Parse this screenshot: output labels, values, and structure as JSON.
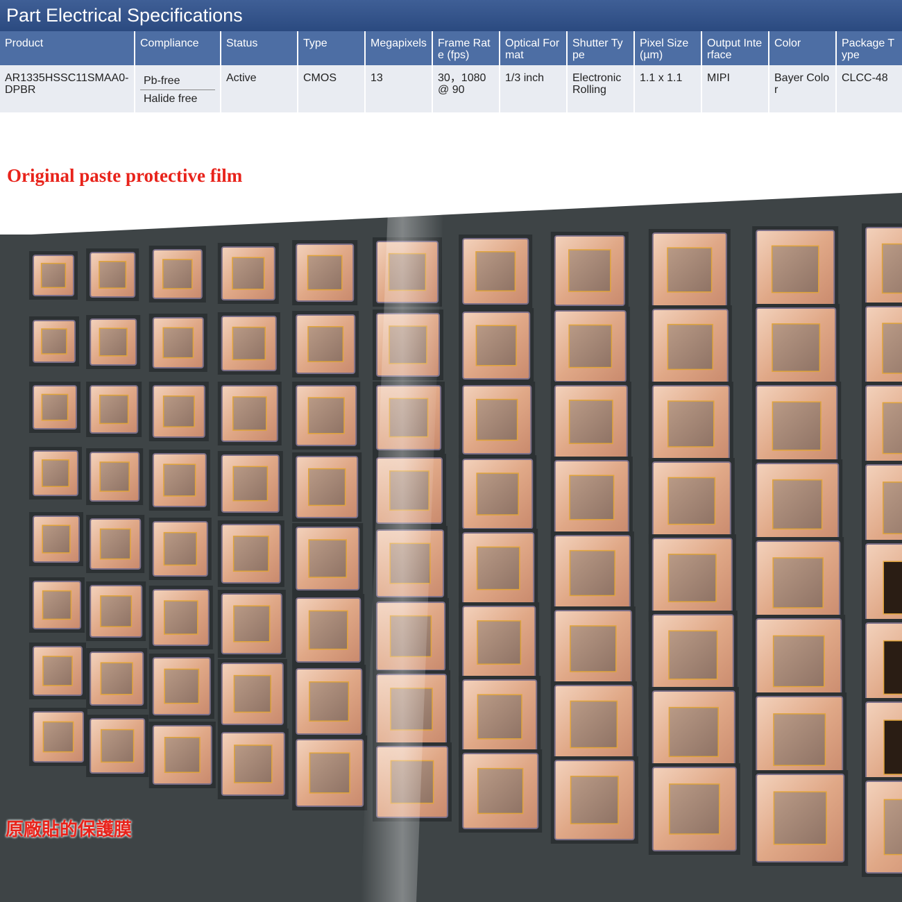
{
  "header": {
    "title": "Part Electrical Specifications"
  },
  "table": {
    "columns": [
      "Product",
      "Compliance",
      "Status",
      "Type",
      "Megapixels",
      "Frame Rate (fps)",
      "Optical Format",
      "Shutter Type",
      "Pixel Size (µm)",
      "Output Interface",
      "Color",
      "Package Type"
    ],
    "row": {
      "product": "AR1335HSSC11SMAA0-DPBR",
      "compliance": [
        "Pb-free",
        "Halide free"
      ],
      "status": "Active",
      "type": "CMOS",
      "megapixels": "13",
      "frame_rate": "30，1080 @ 90",
      "optical_format": "1/3 inch",
      "shutter_type": "Electronic Rolling",
      "pixel_size": "1.1 x 1.1",
      "output_interface": "MIPI",
      "color": "Bayer Color",
      "package_type": "CLCC-48"
    }
  },
  "photo": {
    "caption_en": "Original paste protective film",
    "caption_cn": "原廠貼的保護膜",
    "accent": "#e8231b"
  }
}
